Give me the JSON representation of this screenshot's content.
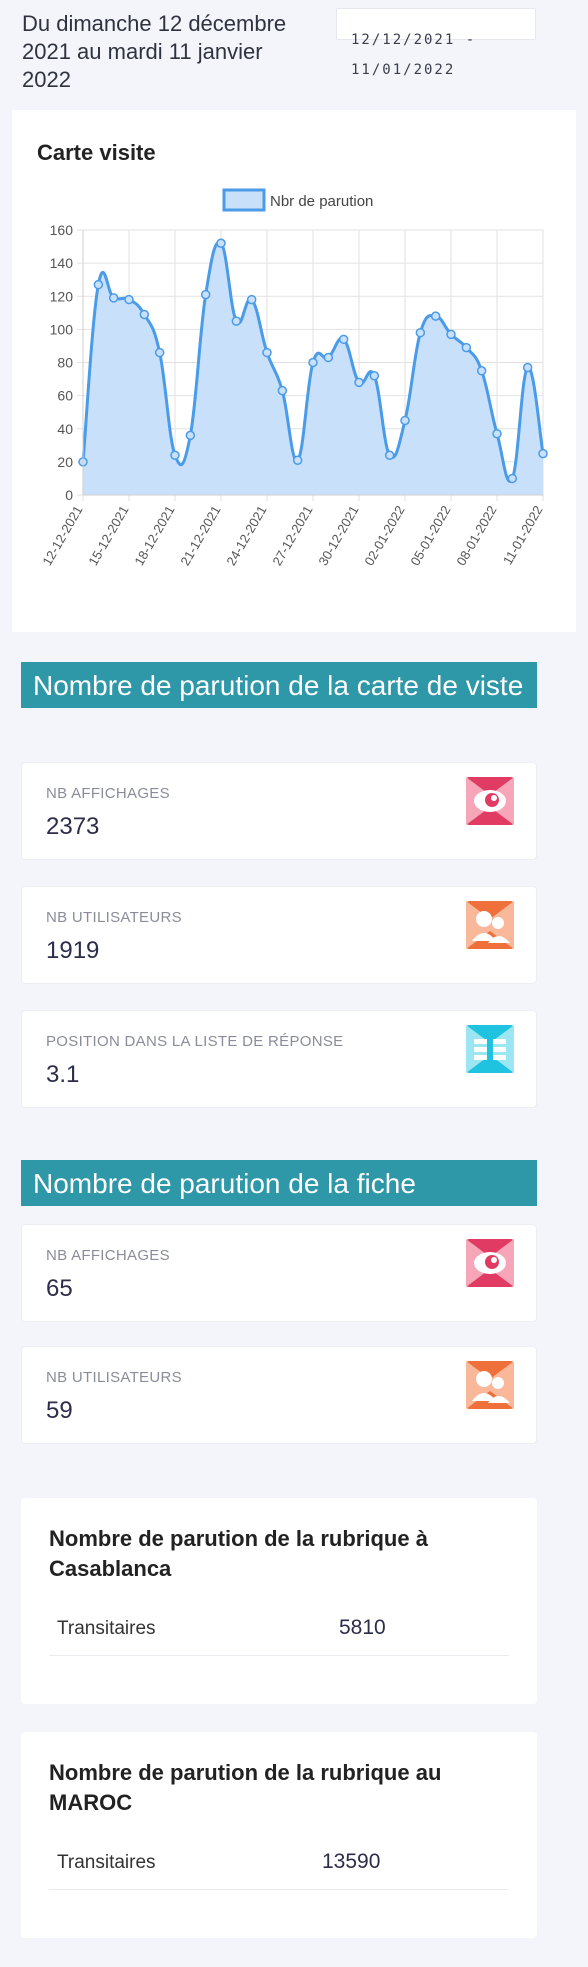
{
  "header": {
    "period_text": "Du dimanche 12 décembre 2021 au mardi 11 janvier 2022",
    "date_range_start": "12/12/2021 -",
    "date_range_end": "11/01/2022"
  },
  "chart_section": {
    "title": "Carte visite"
  },
  "chart_data": {
    "type": "area",
    "title": "",
    "legend": [
      "Nbr de parution"
    ],
    "legend_position": "top",
    "xlabel": "",
    "ylabel": "",
    "ylim": [
      0,
      160
    ],
    "yticks": [
      0,
      20,
      40,
      60,
      80,
      100,
      120,
      140,
      160
    ],
    "grid": true,
    "x_tick_labels": [
      "12-12-2021",
      "15-12-2021",
      "18-12-2021",
      "21-12-2021",
      "24-12-2021",
      "27-12-2021",
      "30-12-2021",
      "02-01-2022",
      "05-01-2022",
      "08-01-2022",
      "11-01-2022"
    ],
    "series": [
      {
        "name": "Nbr de parution",
        "color": "#4a9be8",
        "fill": "#c9e0fa",
        "x": [
          "12-12-2021",
          "13-12-2021",
          "14-12-2021",
          "15-12-2021",
          "16-12-2021",
          "17-12-2021",
          "18-12-2021",
          "19-12-2021",
          "20-12-2021",
          "21-12-2021",
          "22-12-2021",
          "23-12-2021",
          "24-12-2021",
          "25-12-2021",
          "26-12-2021",
          "27-12-2021",
          "28-12-2021",
          "29-12-2021",
          "30-12-2021",
          "31-12-2021",
          "01-01-2022",
          "02-01-2022",
          "03-01-2022",
          "04-01-2022",
          "05-01-2022",
          "06-01-2022",
          "07-01-2022",
          "08-01-2022",
          "09-01-2022",
          "10-01-2022",
          "11-01-2022"
        ],
        "values": [
          20,
          127,
          119,
          118,
          109,
          86,
          24,
          36,
          121,
          152,
          105,
          118,
          86,
          63,
          21,
          80,
          83,
          94,
          68,
          72,
          24,
          45,
          98,
          108,
          97,
          89,
          75,
          37,
          10,
          77,
          25
        ]
      }
    ]
  },
  "carte_section": {
    "title": "Nombre de parution de la carte de viste",
    "cards": [
      {
        "label": "NB AFFICHAGES",
        "value": "2373",
        "icon": "eye-icon",
        "color": "#e03c63"
      },
      {
        "label": "NB UTILISATEURS",
        "value": "1919",
        "icon": "users-icon",
        "color": "#f0703c"
      },
      {
        "label": "POSITION DANS LA LISTE DE RÉPONSE",
        "value": "3.1",
        "icon": "list-icon",
        "color": "#1fc3e0"
      }
    ]
  },
  "fiche_section": {
    "title": "Nombre de parution de la fiche",
    "cards": [
      {
        "label": "NB AFFICHAGES",
        "value": "65",
        "icon": "eye-icon",
        "color": "#e03c63"
      },
      {
        "label": "NB UTILISATEURS",
        "value": "59",
        "icon": "users-icon",
        "color": "#f0703c"
      }
    ]
  },
  "rubrique_casablanca": {
    "title": "Nombre de parution de la rubrique à Casablanca",
    "row_name": "Transitaires",
    "row_count": "5810"
  },
  "rubrique_maroc": {
    "title": "Nombre de parution de la rubrique au MAROC",
    "row_name": "Transitaires",
    "row_count": "13590"
  }
}
